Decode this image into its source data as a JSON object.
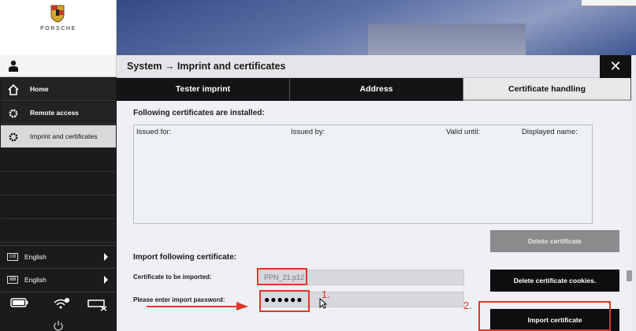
{
  "brand": {
    "name": "PORSCHE"
  },
  "sidebar": {
    "items": [
      {
        "label": "Home",
        "icon": "home-icon"
      },
      {
        "label": "Remote access",
        "icon": "gear-icon"
      },
      {
        "label": "Imprint and certificates",
        "icon": "gear-icon"
      }
    ],
    "languages": [
      {
        "flag": "GB",
        "label": "English"
      },
      {
        "flag": "keyboard",
        "label": "English"
      }
    ]
  },
  "dialog": {
    "title": "System → Imprint and certificates",
    "close_label": "✕",
    "tabs": [
      {
        "label": "Tester imprint"
      },
      {
        "label": "Address"
      },
      {
        "label": "Certificate handling"
      }
    ],
    "installed_title": "Following certificates are installed:",
    "columns": [
      "Issued for:",
      "Issued by:",
      "Valid until:",
      "Displayed name:"
    ],
    "delete_certificate": "Delete certificate",
    "import_title": "Import following certificate:",
    "cert_label": "Certificate to be imported:",
    "cert_value": "PPN_21.p12",
    "password_label": "Please enter import password:",
    "password_value": "●●●●●●",
    "delete_cookies": "Delete certificate cookies.",
    "import_certificate": "Import certificate"
  },
  "annotations": {
    "step1": "1.",
    "step2": "2."
  },
  "colors": {
    "annotation": "#e0362b",
    "sidebar_bg": "#1b1b1d",
    "active_tab": "#e8e8ea"
  }
}
